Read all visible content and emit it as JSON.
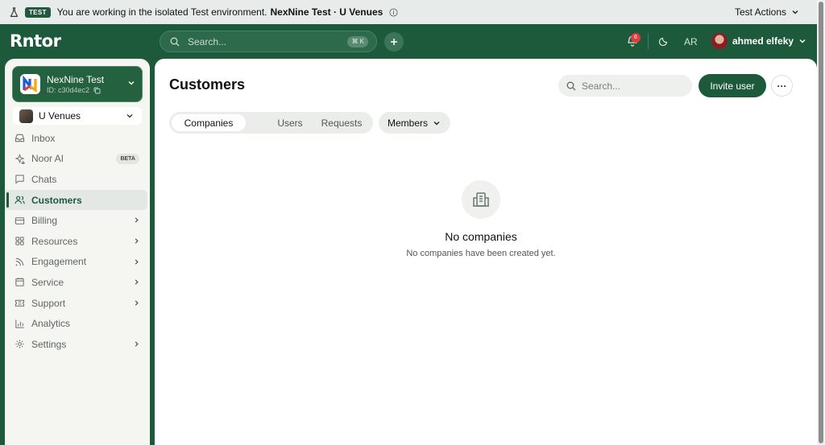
{
  "banner": {
    "badge": "TEST",
    "message": "You are working in the isolated Test environment.",
    "env_name": "NexNine Test · U Venues",
    "actions_label": "Test Actions"
  },
  "header": {
    "logo": "Rntor",
    "search_placeholder": "Search...",
    "search_shortcut": "⌘ K",
    "notification_count": "6",
    "language": "AR",
    "user_name": "ahmed elfeky"
  },
  "sidebar": {
    "org_name": "NexNine Test",
    "org_id": "ID: c30d4ec2",
    "venue": "U Venues",
    "items": [
      {
        "label": "Inbox",
        "icon": "inbox-icon"
      },
      {
        "label": "Noor AI",
        "icon": "sparkle-icon",
        "badge": "BETA"
      },
      {
        "label": "Chats",
        "icon": "chat-icon"
      },
      {
        "label": "Customers",
        "icon": "users-icon",
        "active": true
      },
      {
        "label": "Billing",
        "icon": "credit-card-icon"
      },
      {
        "label": "Resources",
        "icon": "grid-icon"
      },
      {
        "label": "Engagement",
        "icon": "rss-icon"
      },
      {
        "label": "Service",
        "icon": "calendar-icon"
      },
      {
        "label": "Support",
        "icon": "ticket-icon"
      },
      {
        "label": "Analytics",
        "icon": "bar-chart-icon"
      },
      {
        "label": "Settings",
        "icon": "gear-icon"
      }
    ]
  },
  "main": {
    "title": "Customers",
    "search_placeholder": "Search...",
    "invite_label": "Invite user",
    "more_label": "···",
    "tabs": [
      {
        "label": "Companies",
        "active": true
      },
      {
        "label": "Users"
      },
      {
        "label": "Requests"
      }
    ],
    "members_filter": "Members",
    "empty_title": "No companies",
    "empty_subtitle": "No companies have been created yet."
  },
  "colors": {
    "brand": "#1d5a3c",
    "accent_light": "#e3e8e5",
    "notification": "#e23b3b"
  }
}
